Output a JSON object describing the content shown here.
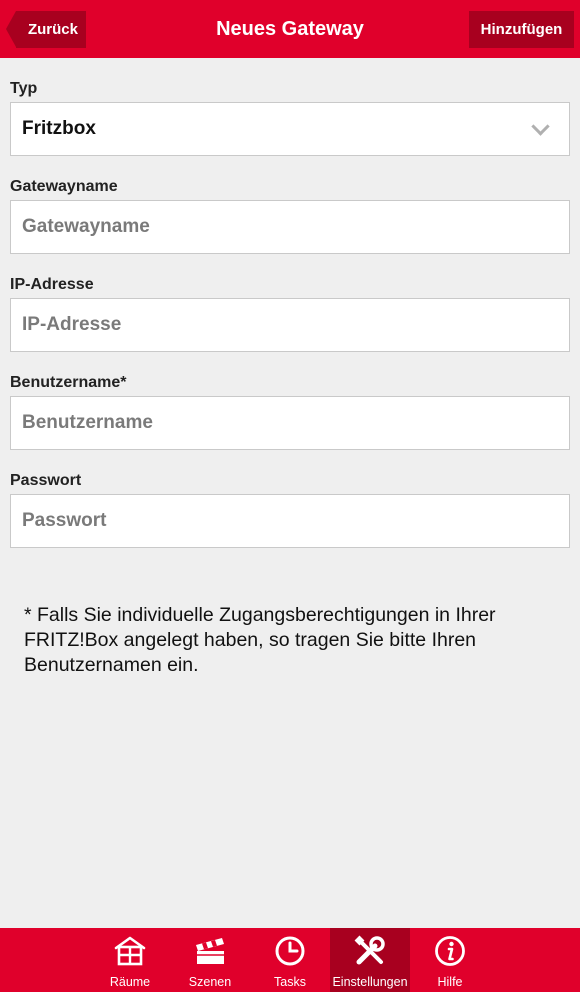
{
  "header": {
    "back_label": "Zurück",
    "title": "Neues Gateway",
    "add_label": "Hinzufügen",
    "accent_color": "#e0002b",
    "dark_accent_color": "#a8001f"
  },
  "form": {
    "type": {
      "label": "Typ",
      "value": "Fritzbox",
      "icon": "chevron-down-icon"
    },
    "gateway_name": {
      "label": "Gatewayname",
      "placeholder": "Gatewayname",
      "value": ""
    },
    "ip_address": {
      "label": "IP-Adresse",
      "placeholder": "IP-Adresse",
      "value": ""
    },
    "username": {
      "label": "Benutzername*",
      "placeholder": "Benutzername",
      "value": ""
    },
    "password": {
      "label": "Passwort",
      "placeholder": "Passwort",
      "value": ""
    }
  },
  "note": "* Falls Sie individuelle Zugangsberechtigungen in Ihrer FRITZ!Box angelegt haben, so tragen Sie bitte Ihren Benutzernamen ein.",
  "tabbar": {
    "active": "Einstellungen",
    "items": [
      {
        "label": "Räume",
        "icon": "house-icon"
      },
      {
        "label": "Szenen",
        "icon": "clapperboard-icon"
      },
      {
        "label": "Tasks",
        "icon": "clock-icon"
      },
      {
        "label": "Einstellungen",
        "icon": "tools-icon"
      },
      {
        "label": "Hilfe",
        "icon": "info-icon"
      }
    ]
  }
}
